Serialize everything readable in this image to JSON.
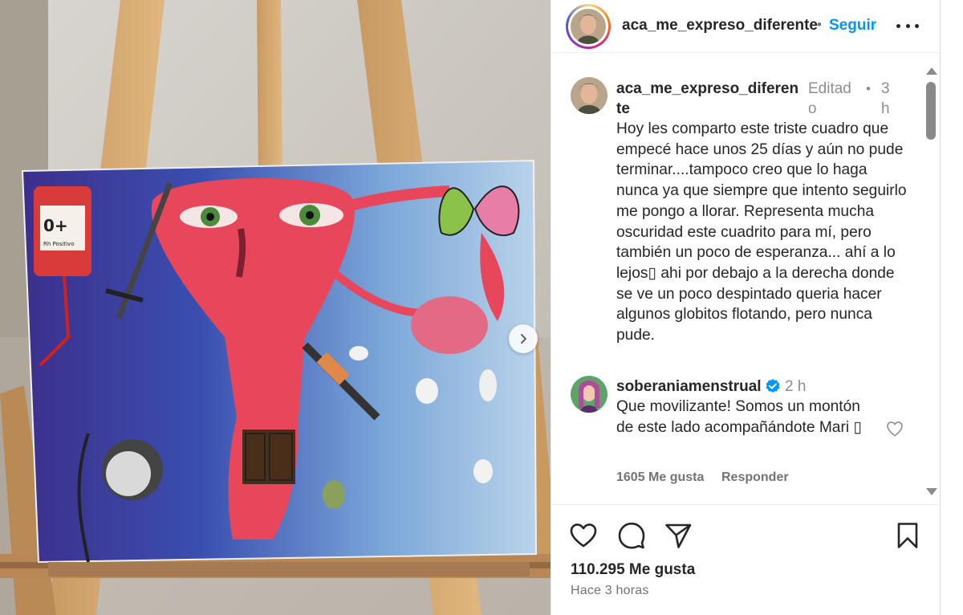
{
  "post": {
    "username": "aca_me_expreso_diferente",
    "dot": "•",
    "follow_label": "Seguir",
    "media_alt_visible_text": "0+ Rh Positivo"
  },
  "caption": {
    "username": "aca_me_expreso_diferente",
    "edited": "Editado",
    "dot": "•",
    "time": "3 h",
    "text": "Hoy les comparto este triste cuadro que empecé hace unos 25 días y aún no pude terminar....tampoco creo que lo haga nunca ya que siempre que intento seguirlo me pongo a llorar. Representa mucha oscuridad este cuadrito para mí, pero también un poco de esperanza... ahí a lo lejos▯ ahi por debajo a la derecha donde se ve un poco despintado queria hacer algunos globitos flotando, pero nunca pude."
  },
  "comment": {
    "username": "soberaniamenstrual",
    "time": "2 h",
    "text": "Que movilizante! Somos un montón de este lado acompañándote Mari ▯",
    "likes": "1605 Me gusta",
    "reply": "Responder"
  },
  "footer": {
    "likes_total": "110.295 Me gusta",
    "posted": "Hace 3 horas"
  },
  "colors": {
    "follow_blue": "#0095f6",
    "verified_blue": "#0095f6",
    "text_primary": "#262626",
    "text_secondary": "#737373"
  },
  "icons": [
    "more-options-icon",
    "heart-icon",
    "comment-icon",
    "share-icon",
    "bookmark-icon",
    "verified-badge-icon",
    "chevron-right-icon"
  ]
}
